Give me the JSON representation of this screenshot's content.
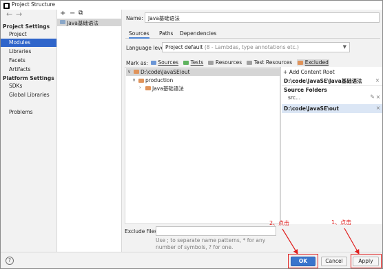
{
  "window": {
    "title": "Project Structure"
  },
  "nav": {
    "back_icon": "←",
    "forward_icon": "→"
  },
  "sidebar": {
    "project_settings_header": "Project Settings",
    "project_settings": [
      "Project",
      "Modules",
      "Libraries",
      "Facets",
      "Artifacts"
    ],
    "platform_settings_header": "Platform Settings",
    "platform_settings": [
      "SDKs",
      "Global Libraries"
    ],
    "problems": "Problems",
    "selected": "Modules"
  },
  "module_list": {
    "add_glyph": "+",
    "remove_glyph": "−",
    "copy_glyph": "⧉",
    "module_name": "Java基础语法"
  },
  "detail": {
    "name_label": "Name:",
    "name_value": "Java基础语法",
    "tabs": [
      "Sources",
      "Paths",
      "Dependencies"
    ],
    "active_tab": "Sources",
    "language_level_label": "Language level:",
    "language_level_value": "Project default",
    "language_level_hint": " (8 - Lambdas, type annotations etc.)",
    "mark_as_label": "Mark as:",
    "mark_as": {
      "sources": "Sources",
      "tests": "Tests",
      "resources": "Resources",
      "test_resources": "Test Resources",
      "excluded": "Excluded"
    },
    "tree": {
      "root": "D:\\code\\JavaSE\\out",
      "child": "production",
      "grandchild": "Java基础语法"
    },
    "content_roots": {
      "add_label": "Add Content Root",
      "root1": "D:\\code\\JavaSE\\Java基础语法",
      "source_folders_label": "Source Folders",
      "src_item": "src",
      "src_suffix": "...",
      "root2": "D:\\code\\JavaSE\\out"
    },
    "exclude_files_label": "Exclude files:",
    "exclude_files_value": "",
    "exclude_hint": "Use ; to separate name patterns, * for any number of symbols, ? for one."
  },
  "footer": {
    "help": "?",
    "ok": "OK",
    "cancel": "Cancel",
    "apply": "Apply"
  },
  "annotations": {
    "step1": "1、点击",
    "step2": "2、点击",
    "color": "#e0201f"
  }
}
